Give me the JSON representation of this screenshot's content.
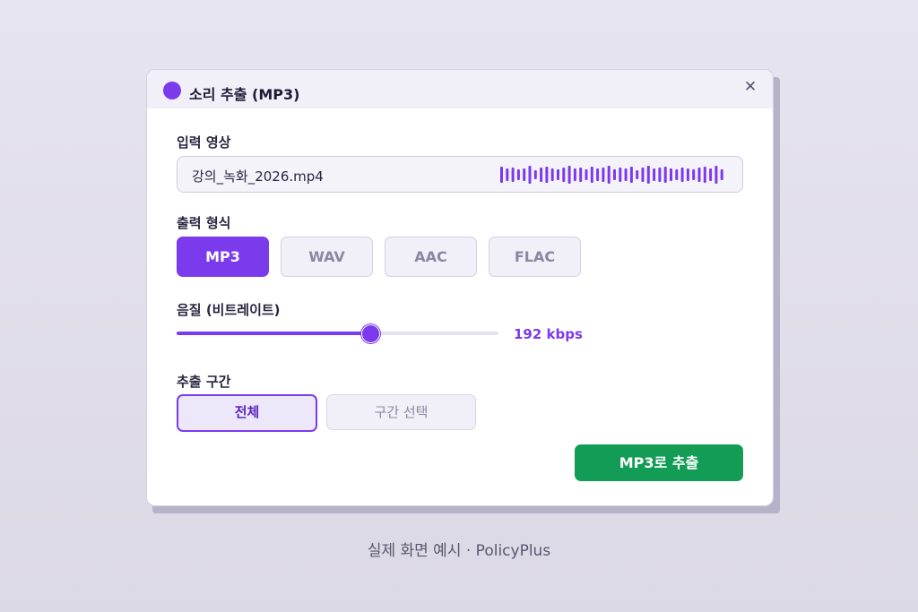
{
  "dialog": {
    "title": "소리 추출 (MP3)",
    "close_label": "✕",
    "accent_color": "#7c3aed",
    "confirm_color": "#139c55"
  },
  "input": {
    "label": "입력 영상",
    "file_name": "강의_녹화_2026.mp4",
    "waveform_icon": "waveform-icon"
  },
  "format": {
    "label": "출력 형식",
    "options": [
      "MP3",
      "WAV",
      "AAC",
      "FLAC"
    ],
    "selected": "MP3"
  },
  "quality": {
    "label": "음질 (비트레이트)",
    "value_text": "192 kbps",
    "slider_fraction": 0.6
  },
  "range": {
    "label": "추출 구간",
    "all_label": "전체",
    "select_label": "구간 선택",
    "selected": "전체"
  },
  "actions": {
    "extract_label": "MP3로 추출"
  },
  "caption": "실제 화면 예시 · PolicyPlus"
}
